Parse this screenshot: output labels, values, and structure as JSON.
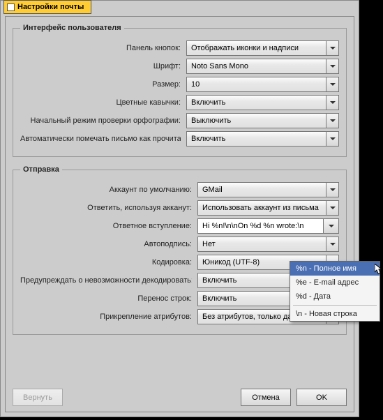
{
  "tab": {
    "title": "Настройки почты"
  },
  "groups": {
    "ui": {
      "legend": "Интерфейс пользователя",
      "rows": {
        "buttons_panel": {
          "label": "Панель кнопок:",
          "value": "Отображать иконки и надписи"
        },
        "font": {
          "label": "Шрифт:",
          "value": "Noto Sans Mono"
        },
        "size": {
          "label": "Размер:",
          "value": "10"
        },
        "color_quotes": {
          "label": "Цветные кавычки:",
          "value": "Включить"
        },
        "spellcheck": {
          "label": "Начальный режим проверки орфографии:",
          "value": "Выключить"
        },
        "auto_read": {
          "label": "Автоматически помечать письмо как прочитанное:",
          "value": "Включить"
        }
      }
    },
    "send": {
      "legend": "Отправка",
      "rows": {
        "default_acct": {
          "label": "Аккаунт по умолчанию:",
          "value": "GMail"
        },
        "reply_acct": {
          "label": "Ответить, используя акканут:",
          "value": "Использовать аккаунт из письма"
        },
        "reply_intro": {
          "label": "Ответное вступление:",
          "value": "Hi %n!\\n\\nOn %d %n wrote:\\n"
        },
        "autosign": {
          "label": "Автоподпись:",
          "value": "Нет"
        },
        "encoding": {
          "label": "Кодировка:",
          "value": "Юникод (UTF-8)"
        },
        "decode_warn": {
          "label": "Предупреждать о невозможности декодировать:",
          "value": "Включить"
        },
        "line_wrap": {
          "label": "Перенос строк:",
          "value": "Включить"
        },
        "attr_attach": {
          "label": "Прикрепление атрибутов:",
          "value": "Без атрибутов, только данные"
        }
      }
    }
  },
  "popup": {
    "items": [
      "%n - Полное имя",
      "%e - E-mail адрес",
      "%d - Дата",
      "\\n - Новая строка"
    ]
  },
  "buttons": {
    "revert": "Вернуть",
    "cancel": "Отмена",
    "ok": "OK"
  }
}
